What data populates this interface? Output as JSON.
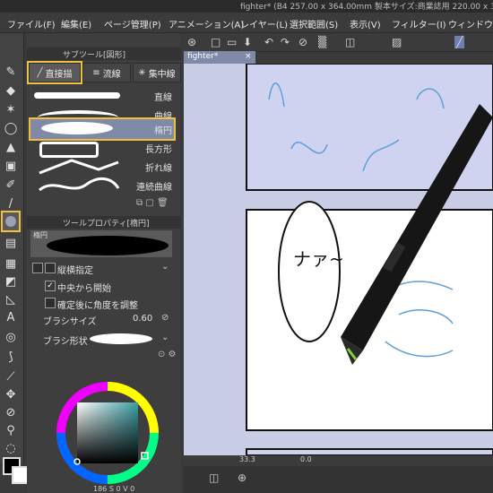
{
  "window": {
    "title": "fighter* (B4 257.00 x 364.00mm 製本サイズ:商業誌用 220.00 x 3"
  },
  "menu": {
    "items": [
      "ファイル(F)",
      "編集(E)",
      "ページ管理(P)",
      "アニメーション(A)",
      "レイヤー(L)",
      "選択範囲(S)",
      "表示(V)",
      "フィルター(I)",
      "ウィンドウ(W)"
    ]
  },
  "subtool_panel": {
    "header": "サブツール[図形]",
    "tabs": [
      "直接描",
      "流線",
      "集中線"
    ],
    "selected_tab": "直接描",
    "brushes": [
      "直線",
      "曲線",
      "楕円",
      "長方形",
      "折れ線",
      "連続曲線"
    ],
    "selected_brush": "楕円"
  },
  "property_panel": {
    "header": "ツールプロパティ[楕円]",
    "preview_label": "楕円",
    "aspect": "縦横指定",
    "start_from_center": "中央から開始",
    "adjust_angle": "確定後に角度を調整",
    "brush_size_label": "ブラシサイズ",
    "brush_size_value": "0.60",
    "brush_shape_label": "ブラシ形状"
  },
  "color_panel": {
    "hue_ring": "color-wheel",
    "selected_color": "#3c7f84",
    "status_values": [
      "186",
      "S",
      "0",
      "V",
      "0"
    ]
  },
  "document": {
    "tab": "fighter*"
  },
  "canvas": {
    "speech_text": "ナァ~",
    "panel_color": "#cfd3f0"
  },
  "statusbar": {
    "zoom": "33.3",
    "angle": "0.0"
  }
}
